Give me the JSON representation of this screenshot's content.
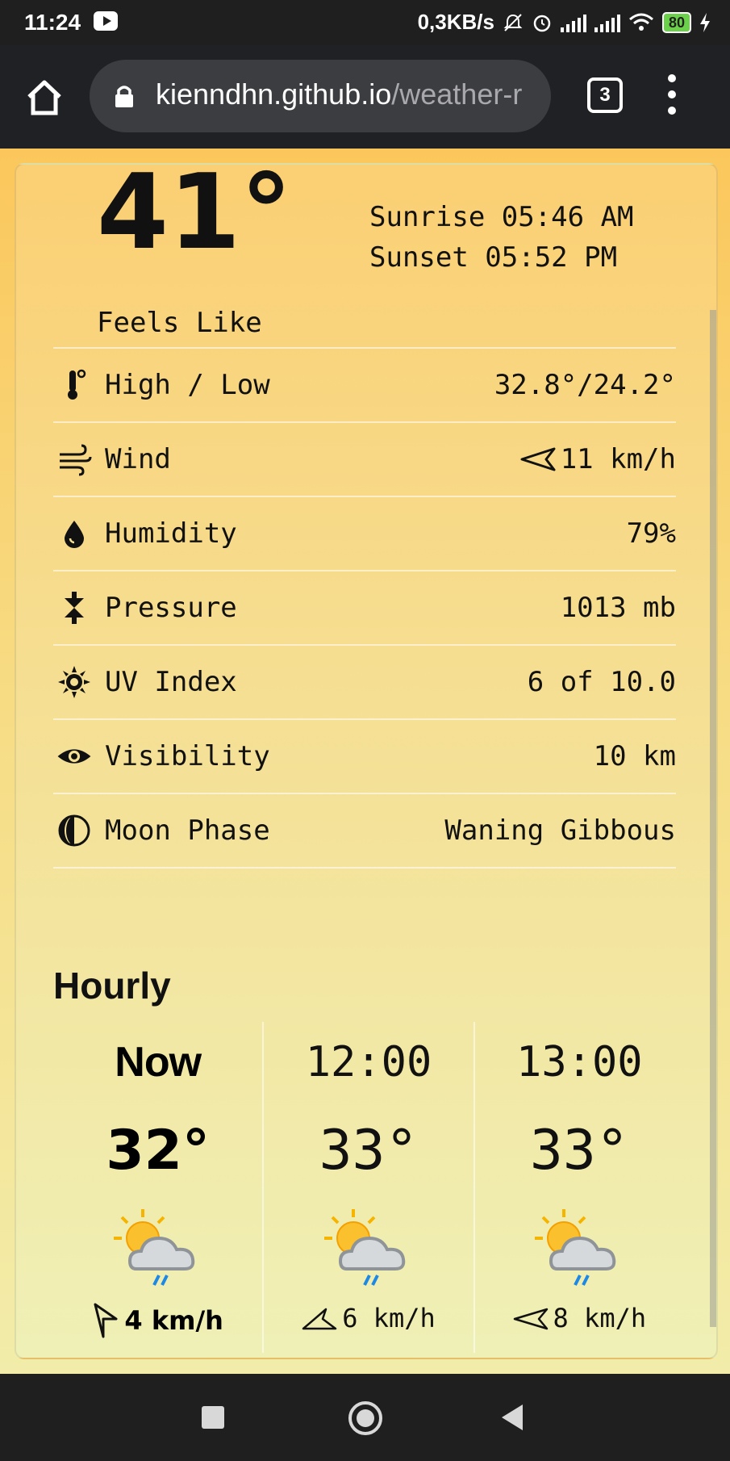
{
  "status_bar": {
    "time": "11:24",
    "network_speed": "0,3KB/s",
    "battery": "80"
  },
  "browser": {
    "url_host": "kienndhn.github.io",
    "url_path": "/weather-r",
    "tab_count": "3"
  },
  "current": {
    "temperature": "41°",
    "feels_like_label": "Feels Like",
    "sunrise": "Sunrise 05:46 AM",
    "sunset": "Sunset 05:52 PM"
  },
  "details": [
    {
      "icon": "thermometer-icon",
      "label": "High / Low",
      "value": "32.8°/24.2°"
    },
    {
      "icon": "wind-icon",
      "label": "Wind",
      "value": "11 km/h",
      "arrow_icon": "wind-direction-icon"
    },
    {
      "icon": "humidity-icon",
      "label": "Humidity",
      "value": "79%"
    },
    {
      "icon": "pressure-icon",
      "label": "Pressure",
      "value": "1013 mb"
    },
    {
      "icon": "uv-icon",
      "label": "UV Index",
      "value": "6 of 10.0"
    },
    {
      "icon": "visibility-icon",
      "label": "Visibility",
      "value": "10 km"
    },
    {
      "icon": "moon-phase-icon",
      "label": "Moon Phase",
      "value": "Waning Gibbous"
    }
  ],
  "hourly": {
    "title": "Hourly",
    "items": [
      {
        "time": "Now",
        "temp": "32°",
        "wind": "4 km/h",
        "weather_icon": "partly-cloudy-rain-icon"
      },
      {
        "time": "12:00",
        "temp": "33°",
        "wind": "6 km/h",
        "weather_icon": "partly-cloudy-rain-icon"
      },
      {
        "time": "13:00",
        "temp": "33°",
        "wind": "8 km/h",
        "weather_icon": "partly-cloudy-rain-icon"
      }
    ]
  },
  "colors": {
    "page_top": "#fbc75c",
    "page_bottom": "#f2ecaa",
    "chrome_bar": "#202124"
  }
}
